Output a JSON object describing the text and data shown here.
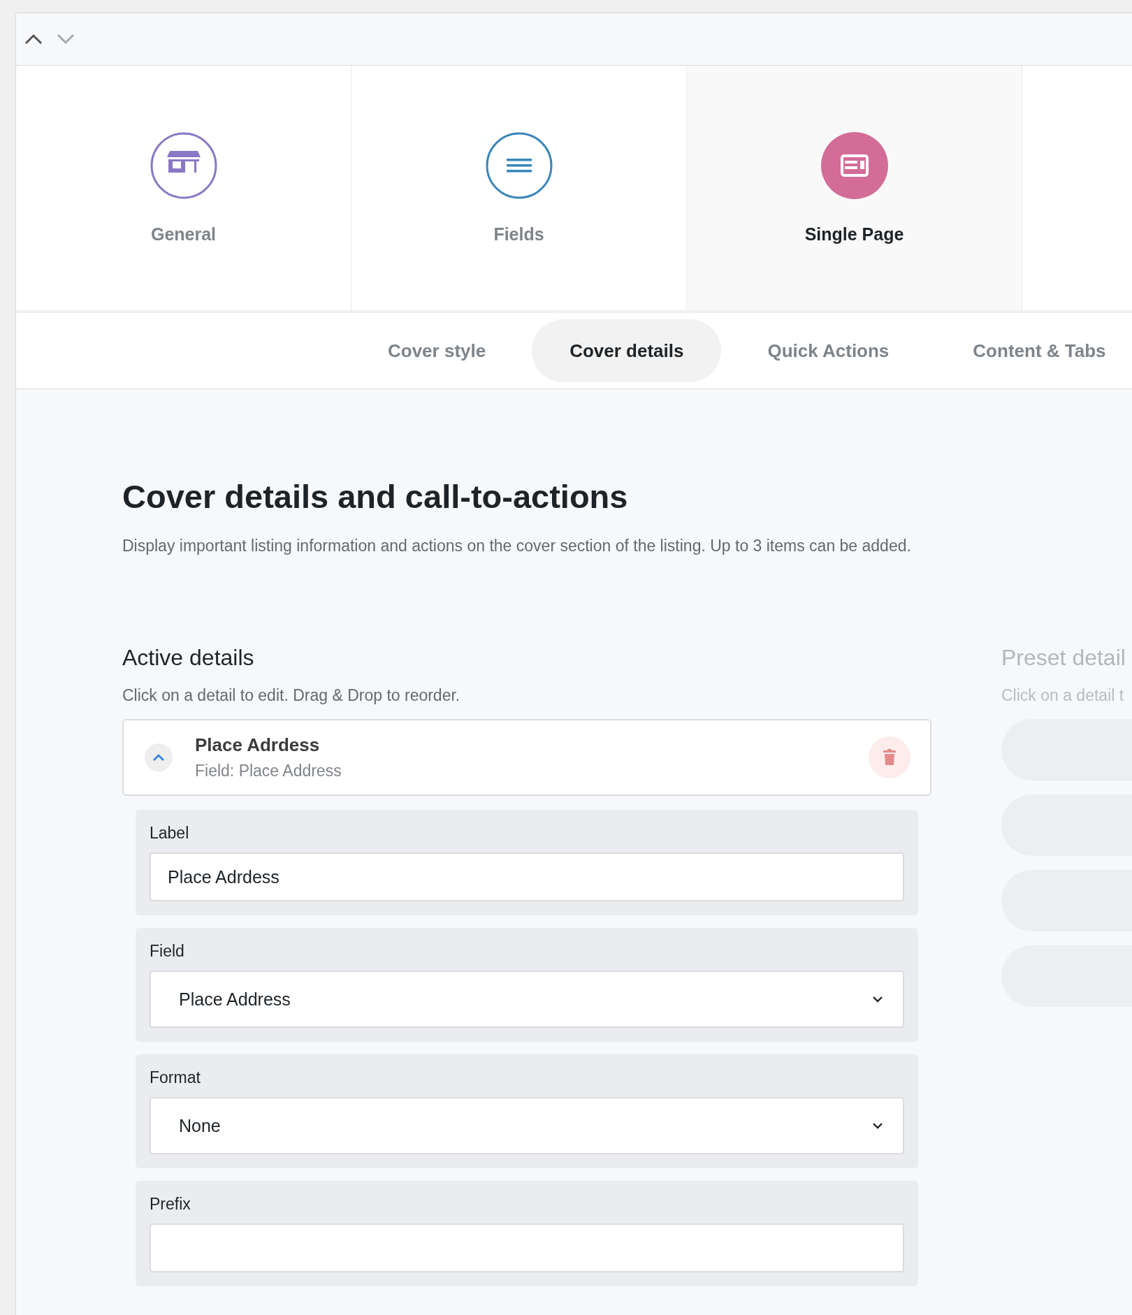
{
  "toolbar": {
    "buttons": [
      {
        "kind": "up",
        "disabled": false
      },
      {
        "kind": "down",
        "disabled": true
      }
    ]
  },
  "steps": [
    {
      "label": "General",
      "kind": "store",
      "color": "#8a78c4",
      "selected": false
    },
    {
      "label": "Fields",
      "kind": "list",
      "color": "#3a86b8",
      "selected": false
    },
    {
      "label": "Single Page",
      "kind": "layout",
      "color": "#d36c97",
      "selected": true
    }
  ],
  "tabs": [
    {
      "label": "Cover style",
      "selected": false
    },
    {
      "label": "Cover details",
      "selected": true
    },
    {
      "label": "Quick Actions",
      "selected": false
    },
    {
      "label": "Content & Tabs",
      "selected": false
    }
  ],
  "heading": "Cover details and call-to-actions",
  "description": "Display important listing information and actions on the cover section of the listing. Up to 3 items can be added.",
  "active": {
    "title": "Active details",
    "hint": "Click on a detail to edit. Drag & Drop to reorder.",
    "items": [
      {
        "title": "Place Adrdess",
        "subtitle": "Field: Place Address",
        "expanded": true,
        "fields": [
          {
            "label": "Label",
            "kind": "text",
            "value": "Place Adrdess"
          },
          {
            "label": "Field",
            "kind": "select",
            "value": "Place Address"
          },
          {
            "label": "Format",
            "kind": "select",
            "value": "None"
          },
          {
            "label": "Prefix",
            "kind": "text"
          }
        ]
      }
    ]
  },
  "preset": {
    "title": "Preset detail",
    "hint": "Click on a detail t"
  }
}
